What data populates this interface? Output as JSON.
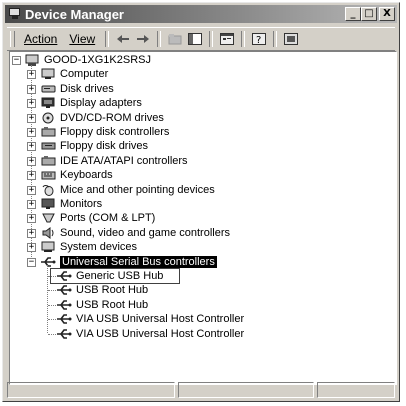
{
  "window": {
    "title": "Device Manager"
  },
  "title_buttons": {
    "minimize": "_",
    "maximize": "□",
    "close": "X"
  },
  "menu": {
    "action": "Action",
    "view": "View"
  },
  "tree": {
    "root": "GOOD-1XG1K2SRSJ",
    "categories": [
      {
        "label": "Computer",
        "icon": "computer-icon"
      },
      {
        "label": "Disk drives",
        "icon": "disk-drive-icon"
      },
      {
        "label": "Display adapters",
        "icon": "display-adapter-icon"
      },
      {
        "label": "DVD/CD-ROM drives",
        "icon": "cdrom-icon"
      },
      {
        "label": "Floppy disk controllers",
        "icon": "controller-icon"
      },
      {
        "label": "Floppy disk drives",
        "icon": "floppy-icon"
      },
      {
        "label": "IDE ATA/ATAPI controllers",
        "icon": "controller-icon"
      },
      {
        "label": "Keyboards",
        "icon": "keyboard-icon"
      },
      {
        "label": "Mice and other pointing devices",
        "icon": "mouse-icon"
      },
      {
        "label": "Monitors",
        "icon": "monitor-icon"
      },
      {
        "label": "Ports (COM & LPT)",
        "icon": "port-icon"
      },
      {
        "label": "Sound, video and game controllers",
        "icon": "sound-icon"
      },
      {
        "label": "System devices",
        "icon": "system-icon"
      },
      {
        "label": "Universal Serial Bus controllers",
        "icon": "usb-icon"
      }
    ],
    "usb_children": [
      "Generic USB Hub",
      "USB Root Hub",
      "USB Root Hub",
      "VIA USB Universal Host Controller",
      "VIA USB Universal Host Controller"
    ]
  }
}
